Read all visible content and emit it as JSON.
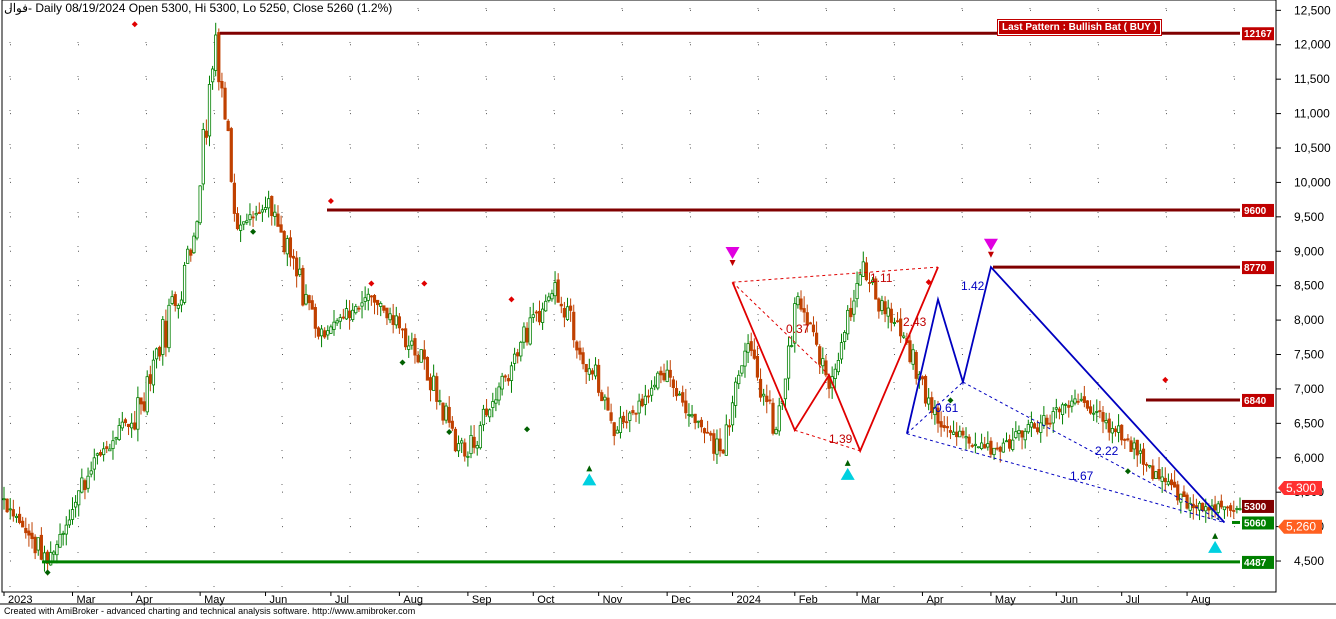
{
  "header": {
    "symbol": "فوال",
    "info": "- Daily 08/19/2024 Open 5300, Hi 5300, Lo 5250, Close 5260 (1.2%)"
  },
  "pattern_label": "Last Pattern : Bullish Bat ( BUY )",
  "footer": "Created with AmiBroker - advanced charting and technical analysis software. http://www.amibroker.com",
  "colors": {
    "up": "#008000",
    "down": "#c04000",
    "resistance": "#800000",
    "support": "#008000",
    "zigzag_red": "#e00000",
    "zigzag_blue": "#0000c0",
    "price_tag": "#ff6020"
  },
  "chart_data": {
    "type": "candlestick",
    "ylim": [
      4050,
      12650
    ],
    "y_ticks": [
      "12,500",
      "12,000",
      "11,500",
      "11,000",
      "10,500",
      "10,000",
      "9,500",
      "9,000",
      "8,500",
      "8,000",
      "7,500",
      "7,000",
      "6,500",
      "6,000",
      "5,500",
      "5,000",
      "4,500"
    ],
    "x_ticks": [
      "2023",
      "Mar",
      "Apr",
      "May",
      "Jun",
      "Jul",
      "Aug",
      "Sep",
      "Oct",
      "Nov",
      "Dec",
      "2024",
      "Feb",
      "Mar",
      "Apr",
      "May",
      "Jun",
      "Jul",
      "Aug"
    ],
    "resistance_levels": [
      {
        "label": "12167",
        "value": 12167
      },
      {
        "label": "9600",
        "value": 9600
      },
      {
        "label": "8770",
        "value": 8770
      },
      {
        "label": "6840",
        "value": 6840
      }
    ],
    "support_levels": [
      {
        "label": "5060",
        "value": 5060
      },
      {
        "label": "4487",
        "value": 4487
      }
    ],
    "price_tags": [
      {
        "label": "5300",
        "value": 5300,
        "style": "dark"
      },
      {
        "label": "5,300",
        "value": 5300,
        "style": "red"
      },
      {
        "label": "5,260",
        "value": 5260,
        "style": "orange"
      }
    ],
    "pattern_ratios": [
      {
        "label": "1.11",
        "color": "red"
      },
      {
        "label": "0.37",
        "color": "red"
      },
      {
        "label": "1.39",
        "color": "red"
      },
      {
        "label": "2.43",
        "color": "red"
      },
      {
        "label": "1.42",
        "color": "blue"
      },
      {
        "label": "0.61",
        "color": "blue"
      },
      {
        "label": "2.22",
        "color": "blue"
      },
      {
        "label": "1.67",
        "color": "blue"
      }
    ],
    "key_points": [
      {
        "date": "2023-01",
        "value": 5400
      },
      {
        "date": "2023-01-end",
        "value": 4487
      },
      {
        "date": "2023-02",
        "value": 5900
      },
      {
        "date": "2023-03",
        "value": 6600
      },
      {
        "date": "2023-04",
        "value": 9000
      },
      {
        "date": "2023-05",
        "value": 12167
      },
      {
        "date": "2023-06",
        "value": 9400
      },
      {
        "date": "2023-07",
        "value": 9600
      },
      {
        "date": "2023-08",
        "value": 7800
      },
      {
        "date": "2023-09",
        "value": 8400
      },
      {
        "date": "2023-10",
        "value": 7500
      },
      {
        "date": "2023-11",
        "value": 6000
      },
      {
        "date": "2023-12",
        "value": 7600
      },
      {
        "date": "2024-01",
        "value": 8550
      },
      {
        "date": "2024-01-end",
        "value": 6400
      },
      {
        "date": "2024-02",
        "value": 7200
      },
      {
        "date": "2024-02-end",
        "value": 6100
      },
      {
        "date": "2024-03",
        "value": 7700
      },
      {
        "date": "2024-03-end",
        "value": 6350
      },
      {
        "date": "2024-04",
        "value": 8300
      },
      {
        "date": "2024-04-mid",
        "value": 7100
      },
      {
        "date": "2024-04-end",
        "value": 8770
      },
      {
        "date": "2024-05",
        "value": 7600
      },
      {
        "date": "2024-06",
        "value": 6500
      },
      {
        "date": "2024-06-end",
        "value": 6100
      },
      {
        "date": "2024-07",
        "value": 6840
      },
      {
        "date": "2024-07-end",
        "value": 6300
      },
      {
        "date": "2024-08",
        "value": 5300
      },
      {
        "date": "2024-08-end",
        "value": 5260
      }
    ]
  }
}
